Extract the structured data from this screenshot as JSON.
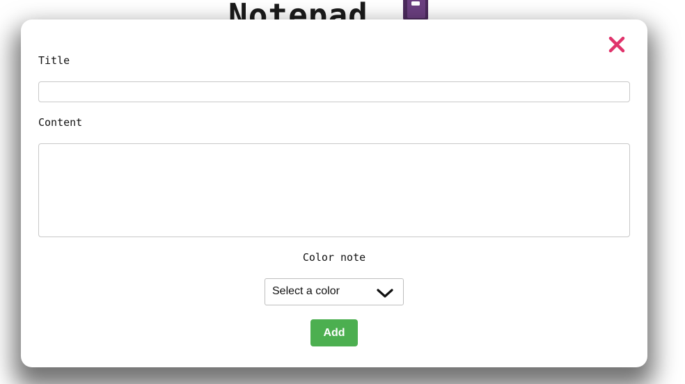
{
  "app": {
    "title": "Notepad",
    "title_icon": "notebook-icon"
  },
  "modal": {
    "close_icon": "close-icon",
    "close_color": "#e0336b",
    "title_label": "Title",
    "title_value": "",
    "content_label": "Content",
    "content_value": "",
    "color_label": "Color note",
    "color_select": {
      "selected": "Select a color",
      "icon": "chevron-down-icon"
    },
    "add_label": "Add",
    "add_color": "#4caf50"
  }
}
